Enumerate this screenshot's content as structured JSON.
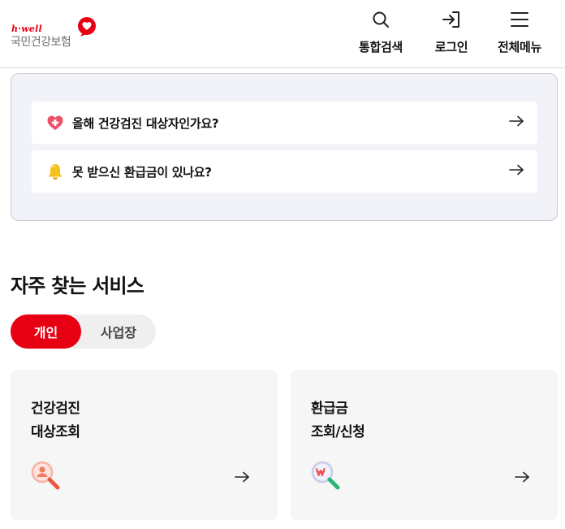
{
  "header": {
    "logo": {
      "tagline": "h·well",
      "name": "국민건강보험"
    },
    "nav": [
      {
        "icon": "search-icon",
        "label": "통합검색"
      },
      {
        "icon": "login-icon",
        "label": "로그인"
      },
      {
        "icon": "menu-icon",
        "label": "전체메뉴"
      }
    ]
  },
  "notice": {
    "items": [
      {
        "icon": "heart-medical-icon",
        "text": "올해 건강검진 대상자인가요?"
      },
      {
        "icon": "bell-icon",
        "text": "못 받으신 환급금이 있나요?"
      }
    ]
  },
  "services": {
    "title": "자주 찾는 서비스",
    "tabs": [
      {
        "label": "개인",
        "active": true
      },
      {
        "label": "사업장",
        "active": false
      }
    ],
    "cards": [
      {
        "title_line1": "건강검진",
        "title_line2": "대상조회",
        "icon": "person-search-icon"
      },
      {
        "title_line1": "환급금",
        "title_line2": "조회/신청",
        "icon": "won-search-icon"
      }
    ]
  },
  "colors": {
    "brand_red": "#e60012",
    "notice_bg": "#f2f3f8",
    "card_bg": "#f6f6f6"
  }
}
